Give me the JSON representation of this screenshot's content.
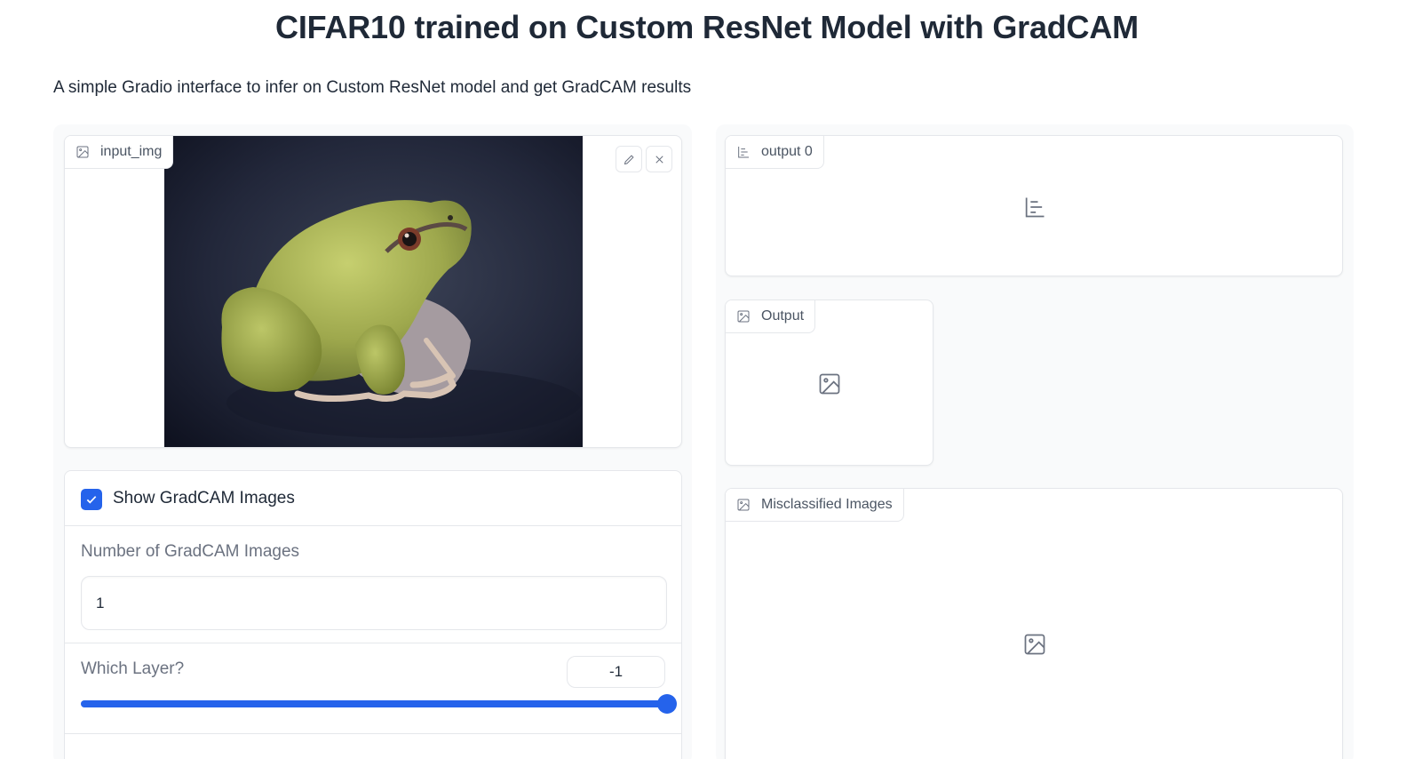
{
  "header": {
    "title": "CIFAR10 trained on Custom ResNet Model with GradCAM",
    "description": "A simple Gradio interface to infer on Custom ResNet model and get GradCAM results"
  },
  "input_image": {
    "label": "input_img",
    "icon": "image-icon",
    "edit_icon": "pencil-icon",
    "clear_icon": "close-icon"
  },
  "controls": {
    "show_gradcam": {
      "label": "Show GradCAM Images",
      "checked": true
    },
    "num_gradcam": {
      "label": "Number of GradCAM Images",
      "value": "1"
    },
    "which_layer": {
      "label": "Which Layer?",
      "value": "-1",
      "fill_fraction": 1.0
    }
  },
  "outputs": {
    "label_output": {
      "label": "output 0",
      "icon": "bar-chart-icon"
    },
    "image_output": {
      "label": "Output",
      "icon": "image-icon"
    },
    "gallery_output": {
      "label": "Misclassified Images",
      "icon": "image-icon"
    }
  },
  "colors": {
    "accent": "#2563eb",
    "border": "#e5e7eb",
    "muted_text": "#6b7280",
    "background_column": "#f9fafb"
  }
}
